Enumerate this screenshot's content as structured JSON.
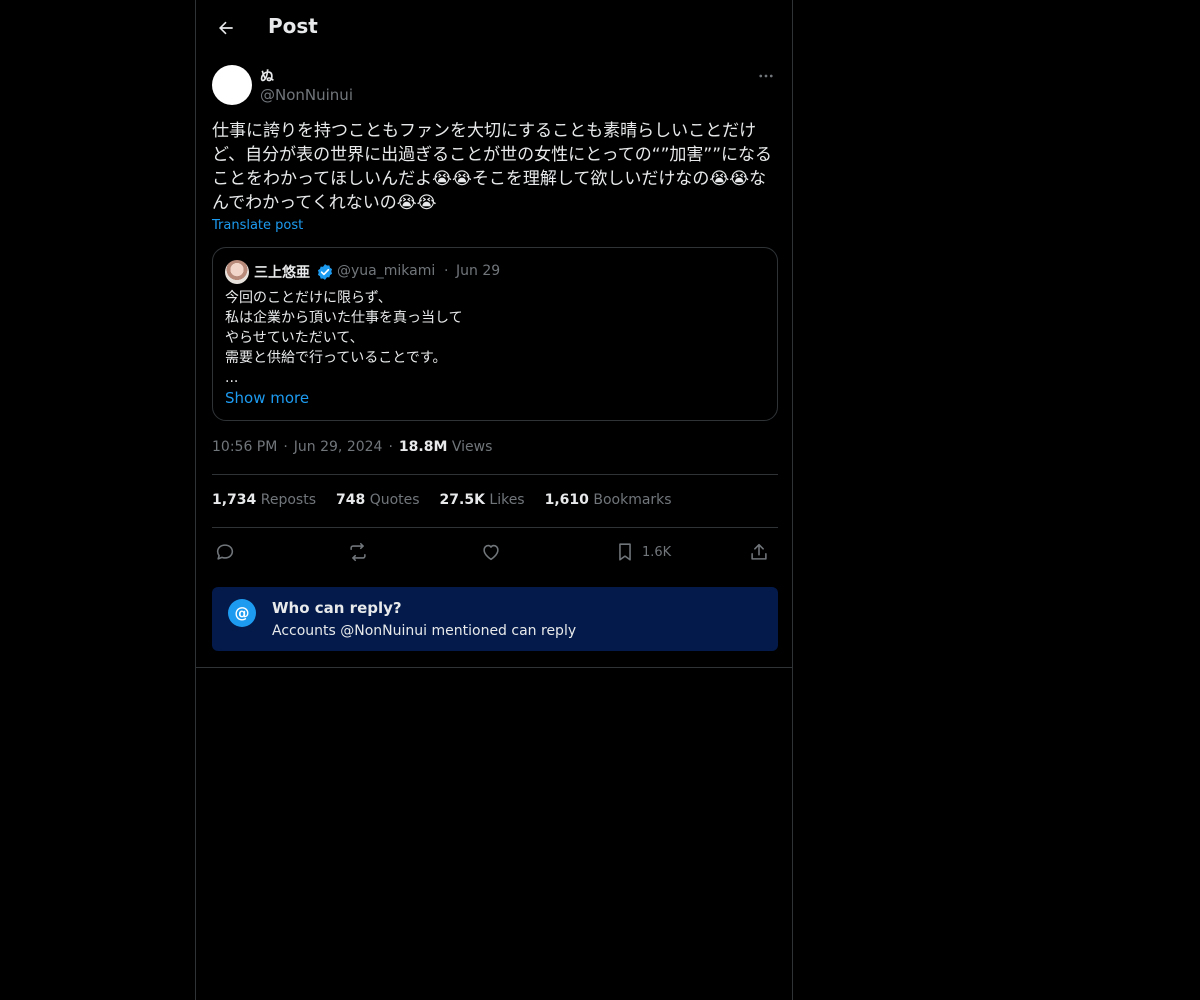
{
  "header": {
    "title": "Post",
    "back_icon": "arrow-left-icon"
  },
  "post": {
    "author": {
      "display_name": "ぬ",
      "handle": "@NonNuinui"
    },
    "text": "仕事に誇りを持つこともファンを大切にすることも素晴らしいことだけど、自分が表の世界に出過ぎることが世の女性にとっての“”加害””になることをわかってほしいんだよ😭😭そこを理解して欲しいだけなの😭😭なんでわかってくれないの😭😭",
    "translate_label": "Translate post",
    "time": "10:56 PM",
    "date": "Jun 29, 2024",
    "views_count": "18.8M",
    "views_label": "Views"
  },
  "quote": {
    "display_name": "三上悠亜",
    "handle": "@yua_mikami",
    "date": "Jun 29",
    "text": "今回のことだけに限らず、\n私は企業から頂いた仕事を真っ当して\nやらせていただいて、\n需要と供給で行っていることです。\n...",
    "show_more_label": "Show more"
  },
  "stats": [
    {
      "count": "1,734",
      "label": "Reposts"
    },
    {
      "count": "748",
      "label": "Quotes"
    },
    {
      "count": "27.5K",
      "label": "Likes"
    },
    {
      "count": "1,610",
      "label": "Bookmarks"
    }
  ],
  "actions": {
    "reply_icon": "reply-icon",
    "repost_icon": "repost-icon",
    "like_icon": "heart-icon",
    "bookmark_icon": "bookmark-icon",
    "bookmark_count": "1.6K",
    "share_icon": "share-icon"
  },
  "reply_restriction": {
    "title": "Who can reply?",
    "subtitle": "Accounts @NonNuinui mentioned can reply"
  },
  "colors": {
    "background": "#000000",
    "accent": "#1d9bf0",
    "muted_text": "#71767b",
    "reply_box_bg": "#031a4a"
  }
}
